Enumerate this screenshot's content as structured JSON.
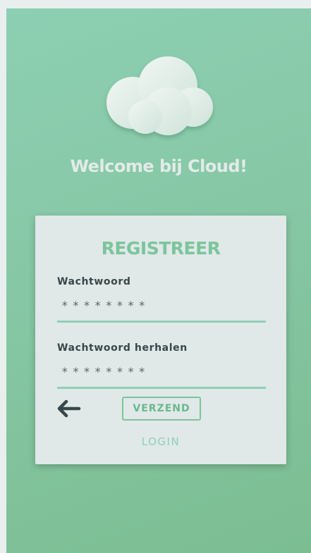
{
  "icons": {
    "logo": "cloud-icon",
    "back": "arrow-left-icon"
  },
  "colors": {
    "background": "#86c7a5",
    "card": "#e0e8e8",
    "accent": "#7cc59c",
    "underline": "#8fd0b5",
    "text_dark": "#37474a"
  },
  "header": {
    "welcome": "Welcome bij Cloud!"
  },
  "register_card": {
    "title": "REGISTREER",
    "password": {
      "label": "Wachtwoord",
      "value": "********"
    },
    "password_repeat": {
      "label": "Wachtwoord herhalen",
      "value": "********"
    },
    "submit_label": "VERZEND",
    "login_label": "LOGIN"
  }
}
